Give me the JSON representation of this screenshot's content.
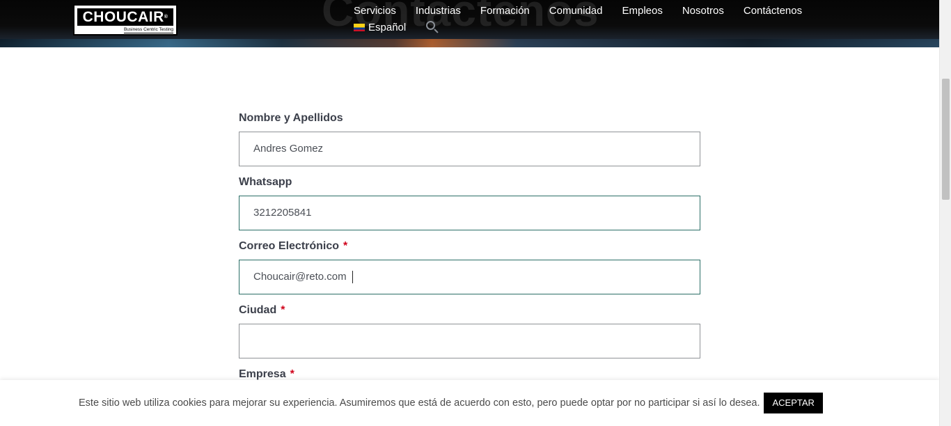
{
  "header": {
    "hero_title": "Contáctenos",
    "logo": {
      "brand": "CHOUCAIR",
      "registered_mark": "®",
      "tagline": "Business Centric Testing"
    },
    "nav": [
      "Servicios",
      "Industrias",
      "Formación",
      "Comunidad",
      "Empleos",
      "Nosotros",
      "Contáctenos"
    ],
    "language": "Español"
  },
  "form": {
    "fields": [
      {
        "label": "Nombre y Apellidos",
        "required": false,
        "value": "Andres Gomez"
      },
      {
        "label": "Whatsapp",
        "required": false,
        "value": "3212205841"
      },
      {
        "label": "Correo Electrónico",
        "required": true,
        "value": "Choucair@reto.com"
      },
      {
        "label": "Ciudad",
        "required": true,
        "value": ""
      },
      {
        "label": "Empresa",
        "required": true
      }
    ],
    "required_mark": "*"
  },
  "cookie_bar": {
    "text": "Este sitio web utiliza cookies para mejorar su experiencia. Asumiremos que está de acuerdo con esto, pero puede optar por no participar si así lo desea.",
    "accept_label": "ACEPTAR"
  },
  "colors": {
    "header_bg": "#000000",
    "focus_border": "#2a6d66",
    "required_mark": "#d0021b",
    "label_text": "#3b3f4a",
    "accept_button_bg": "#000000"
  }
}
